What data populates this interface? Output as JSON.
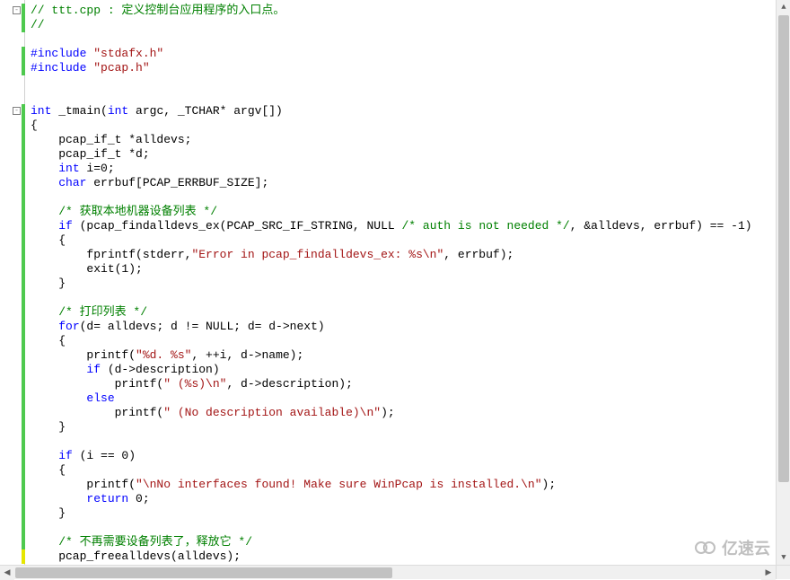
{
  "watermark": {
    "text": "亿速云"
  },
  "fold_markers": [
    {
      "line": 0,
      "symbol": "-"
    },
    {
      "line": 7,
      "symbol": "-"
    }
  ],
  "change_bars": [
    {
      "from_line": 0,
      "to_line": 1,
      "color": "green"
    },
    {
      "from_line": 3,
      "to_line": 4,
      "color": "green"
    },
    {
      "from_line": 7,
      "to_line": 37,
      "color": "green"
    },
    {
      "from_line": 38,
      "to_line": 38,
      "color": "yellow"
    }
  ],
  "code": {
    "tabstop": "    ",
    "lines": [
      {
        "indent": 0,
        "tokens": [
          {
            "t": "comment",
            "v": "// ttt.cpp : 定义控制台应用程序的入口点。"
          }
        ]
      },
      {
        "indent": 0,
        "tokens": [
          {
            "t": "comment",
            "v": "//"
          }
        ]
      },
      {
        "indent": 0,
        "tokens": []
      },
      {
        "indent": 0,
        "tokens": [
          {
            "t": "keyword",
            "v": "#include "
          },
          {
            "t": "string",
            "v": "\"stdafx.h\""
          }
        ]
      },
      {
        "indent": 0,
        "tokens": [
          {
            "t": "keyword",
            "v": "#include "
          },
          {
            "t": "string",
            "v": "\"pcap.h\""
          }
        ]
      },
      {
        "indent": 0,
        "tokens": []
      },
      {
        "indent": 0,
        "tokens": []
      },
      {
        "indent": 0,
        "tokens": [
          {
            "t": "keyword",
            "v": "int"
          },
          {
            "t": "plain",
            "v": " _tmain("
          },
          {
            "t": "keyword",
            "v": "int"
          },
          {
            "t": "plain",
            "v": " argc, _TCHAR* argv[])"
          }
        ]
      },
      {
        "indent": 0,
        "tokens": [
          {
            "t": "plain",
            "v": "{"
          }
        ]
      },
      {
        "indent": 1,
        "tokens": [
          {
            "t": "plain",
            "v": "pcap_if_t *alldevs;"
          }
        ]
      },
      {
        "indent": 1,
        "tokens": [
          {
            "t": "plain",
            "v": "pcap_if_t *d;"
          }
        ]
      },
      {
        "indent": 1,
        "tokens": [
          {
            "t": "keyword",
            "v": "int"
          },
          {
            "t": "plain",
            "v": " i=0;"
          }
        ]
      },
      {
        "indent": 1,
        "tokens": [
          {
            "t": "keyword",
            "v": "char"
          },
          {
            "t": "plain",
            "v": " errbuf[PCAP_ERRBUF_SIZE];"
          }
        ]
      },
      {
        "indent": 0,
        "tokens": []
      },
      {
        "indent": 1,
        "tokens": [
          {
            "t": "comment",
            "v": "/* 获取本地机器设备列表 */"
          }
        ]
      },
      {
        "indent": 1,
        "tokens": [
          {
            "t": "keyword",
            "v": "if"
          },
          {
            "t": "plain",
            "v": " (pcap_findalldevs_ex(PCAP_SRC_IF_STRING, NULL "
          },
          {
            "t": "comment",
            "v": "/* auth is not needed */"
          },
          {
            "t": "plain",
            "v": ", &alldevs, errbuf) == -1)"
          }
        ]
      },
      {
        "indent": 1,
        "tokens": [
          {
            "t": "plain",
            "v": "{"
          }
        ]
      },
      {
        "indent": 2,
        "tokens": [
          {
            "t": "plain",
            "v": "fprintf(stderr,"
          },
          {
            "t": "string",
            "v": "\"Error in pcap_findalldevs_ex: %s\\n\""
          },
          {
            "t": "plain",
            "v": ", errbuf);"
          }
        ]
      },
      {
        "indent": 2,
        "tokens": [
          {
            "t": "plain",
            "v": "exit(1);"
          }
        ]
      },
      {
        "indent": 1,
        "tokens": [
          {
            "t": "plain",
            "v": "}"
          }
        ]
      },
      {
        "indent": 0,
        "tokens": []
      },
      {
        "indent": 1,
        "tokens": [
          {
            "t": "comment",
            "v": "/* 打印列表 */"
          }
        ]
      },
      {
        "indent": 1,
        "tokens": [
          {
            "t": "keyword",
            "v": "for"
          },
          {
            "t": "plain",
            "v": "(d= alldevs; d != NULL; d= d->next)"
          }
        ]
      },
      {
        "indent": 1,
        "tokens": [
          {
            "t": "plain",
            "v": "{"
          }
        ]
      },
      {
        "indent": 2,
        "tokens": [
          {
            "t": "plain",
            "v": "printf("
          },
          {
            "t": "string",
            "v": "\"%d. %s\""
          },
          {
            "t": "plain",
            "v": ", ++i, d->name);"
          }
        ]
      },
      {
        "indent": 2,
        "tokens": [
          {
            "t": "keyword",
            "v": "if"
          },
          {
            "t": "plain",
            "v": " (d->description)"
          }
        ]
      },
      {
        "indent": 3,
        "tokens": [
          {
            "t": "plain",
            "v": "printf("
          },
          {
            "t": "string",
            "v": "\" (%s)\\n\""
          },
          {
            "t": "plain",
            "v": ", d->description);"
          }
        ]
      },
      {
        "indent": 2,
        "tokens": [
          {
            "t": "keyword",
            "v": "else"
          }
        ]
      },
      {
        "indent": 3,
        "tokens": [
          {
            "t": "plain",
            "v": "printf("
          },
          {
            "t": "string",
            "v": "\" (No description available)\\n\""
          },
          {
            "t": "plain",
            "v": ");"
          }
        ]
      },
      {
        "indent": 1,
        "tokens": [
          {
            "t": "plain",
            "v": "}"
          }
        ]
      },
      {
        "indent": 0,
        "tokens": []
      },
      {
        "indent": 1,
        "tokens": [
          {
            "t": "keyword",
            "v": "if"
          },
          {
            "t": "plain",
            "v": " (i == 0)"
          }
        ]
      },
      {
        "indent": 1,
        "tokens": [
          {
            "t": "plain",
            "v": "{"
          }
        ]
      },
      {
        "indent": 2,
        "tokens": [
          {
            "t": "plain",
            "v": "printf("
          },
          {
            "t": "string",
            "v": "\"\\nNo interfaces found! Make sure WinPcap is installed.\\n\""
          },
          {
            "t": "plain",
            "v": ");"
          }
        ]
      },
      {
        "indent": 2,
        "tokens": [
          {
            "t": "keyword",
            "v": "return"
          },
          {
            "t": "plain",
            "v": " 0;"
          }
        ]
      },
      {
        "indent": 1,
        "tokens": [
          {
            "t": "plain",
            "v": "}"
          }
        ]
      },
      {
        "indent": 0,
        "tokens": []
      },
      {
        "indent": 1,
        "tokens": [
          {
            "t": "comment",
            "v": "/* 不再需要设备列表了，释放它 */"
          }
        ]
      },
      {
        "indent": 1,
        "tokens": [
          {
            "t": "plain",
            "v": "pcap_freealldevs(alldevs);"
          }
        ]
      }
    ]
  }
}
